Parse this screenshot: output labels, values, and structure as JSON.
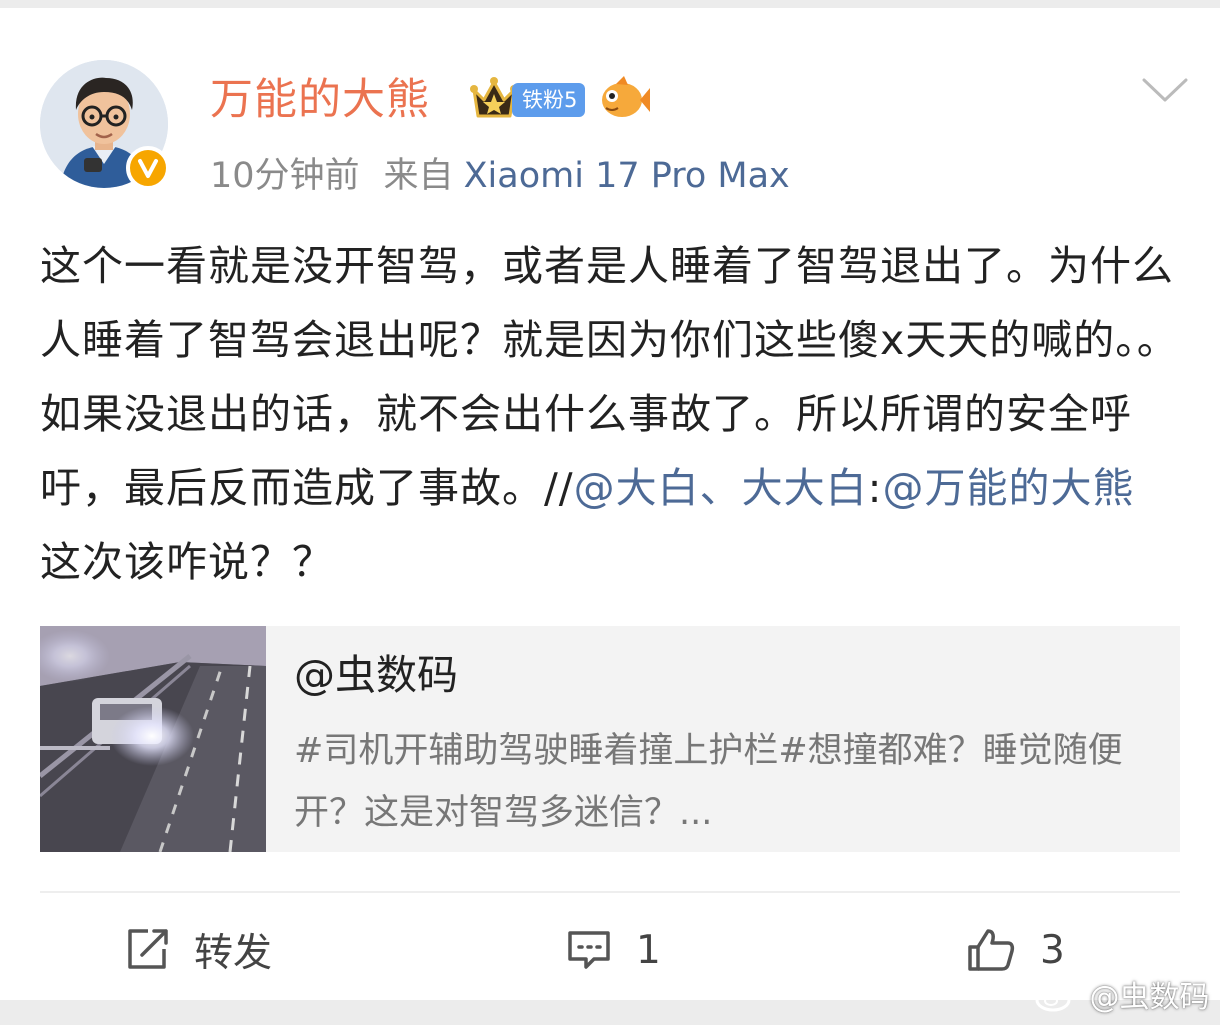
{
  "post": {
    "author": "万能的大熊",
    "fan_badge": "铁粉5",
    "time": "10分钟前",
    "source_label": "来自",
    "device": "Xiaomi 17 Pro Max",
    "text_main": "这个一看就是没开智驾，或者是人睡着了智驾退出了。为什么人睡着了智驾会退出呢？就是因为你们这些傻x天天的喊的。。如果没退出的话，就不会出什么事故了。所以所谓的安全呼吁，最后反而造成了事故。//",
    "mention_1": "@大白、大大白",
    "colon": ":",
    "mention_2": "@万能的大熊",
    "text_tail": " 这次该咋说？？"
  },
  "repost": {
    "author": "@虫数码",
    "text": "#司机开辅助驾驶睡着撞上护栏#想撞都难？睡觉随便开？这是对智驾多迷信？..."
  },
  "actions": {
    "repost_label": "转发",
    "comment_count": "1",
    "like_count": "3"
  },
  "watermark": "@虫数码",
  "icons": [
    "verified-v-icon",
    "crown-level-icon",
    "fish-icon",
    "chevron-down-icon",
    "share-icon",
    "comment-icon",
    "thumbs-up-icon",
    "weibo-logo-icon"
  ],
  "colors": {
    "username": "#eb7350",
    "link": "#4d6a96",
    "badge": "#5d9cec",
    "verified": "#f7a600"
  }
}
